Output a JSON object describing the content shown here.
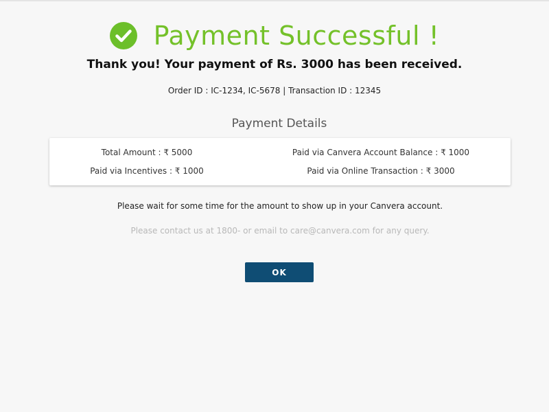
{
  "header": {
    "title": "Payment Successful !",
    "icon": "check-circle-icon",
    "icon_color": "#6cbf2a"
  },
  "message": {
    "thanks": "Thank you! Your payment of Rs. 3000 has been received.",
    "ids": "Order ID : IC-1234, IC-5678 | Transaction ID : 12345"
  },
  "details": {
    "title": "Payment Details",
    "total_amount": "Total Amount : ₹ 5000",
    "account_balance": "Paid via  Canvera Account Balance : ₹ 1000",
    "incentives": "Paid via Incentives : ₹ 1000",
    "online": "Paid via Online Transaction : ₹ 3000"
  },
  "notes": {
    "wait": "Please wait for some time for the amount to show up in your Canvera account.",
    "contact": "Please contact us at 1800- or email to care@canvera.com for any query."
  },
  "actions": {
    "ok_label": "OK",
    "ok_color": "#0f4d74"
  },
  "colors": {
    "success_green": "#74c12a",
    "background": "#f7f7f7"
  }
}
